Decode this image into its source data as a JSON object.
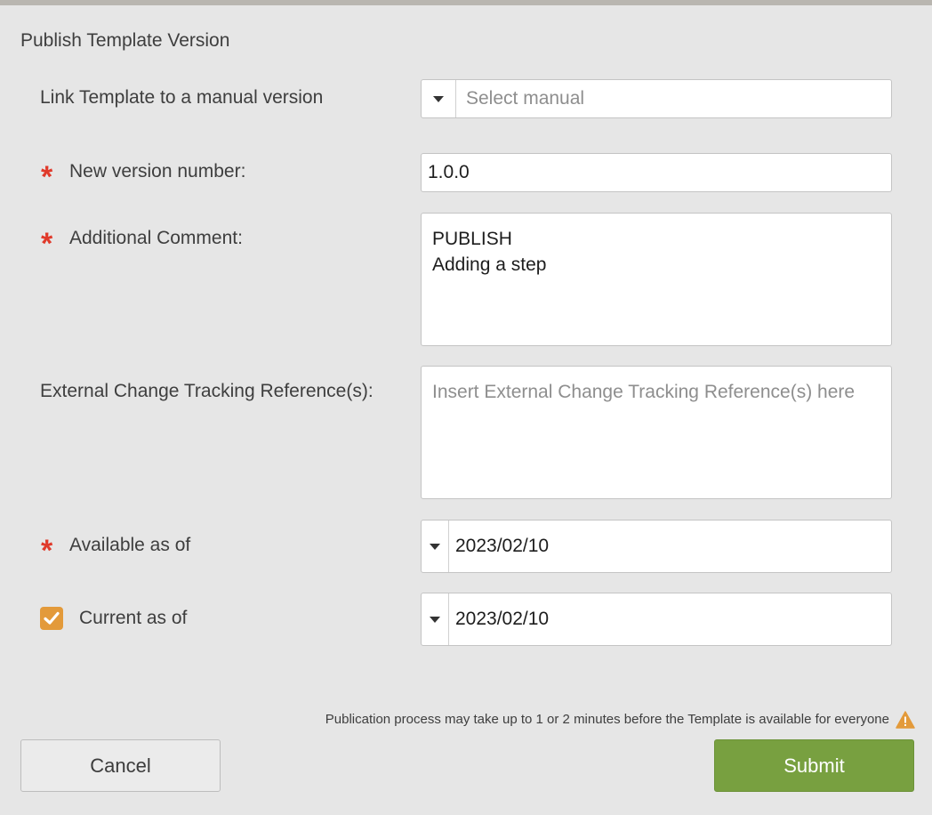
{
  "dialog": {
    "title": "Publish Template Version"
  },
  "form": {
    "manual": {
      "label": "Link Template to a manual version",
      "placeholder": "Select manual"
    },
    "version": {
      "label": "New version number:",
      "value": "1.0.0"
    },
    "comment": {
      "label": "Additional Comment:",
      "value": "PUBLISH\nAdding a step"
    },
    "tracking": {
      "label": "External Change Tracking Reference(s):",
      "placeholder": "Insert External Change Tracking Reference(s) here"
    },
    "available": {
      "label": "Available as of",
      "value": "2023/02/10"
    },
    "current": {
      "label": "Current as of",
      "value": "2023/02/10",
      "checked": true
    },
    "required_mark": "*"
  },
  "footer": {
    "notice": "Publication process may take up to 1 or 2 minutes before the Template is available for everyone",
    "cancel_label": "Cancel",
    "submit_label": "Submit"
  },
  "colors": {
    "required": "#e03a2b",
    "checkbox": "#e39a3a",
    "submit": "#78a040",
    "warning": "#e39a3a"
  },
  "icons": {
    "dropdown": "caret-down-icon",
    "checkbox": "checkmark-icon",
    "warning": "warning-triangle-icon"
  }
}
